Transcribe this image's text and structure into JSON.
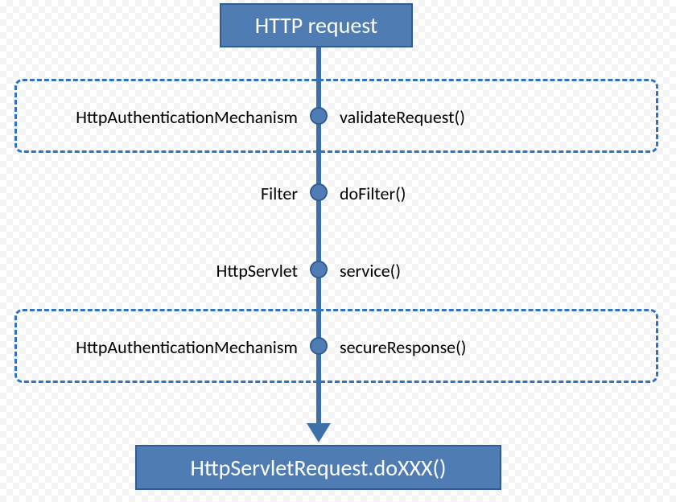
{
  "top_box": {
    "label": "HTTP request"
  },
  "bottom_box": {
    "label": "HttpServletRequest.doXXX()"
  },
  "steps": [
    {
      "component": "HttpAuthenticationMechanism",
      "method": "validateRequest()"
    },
    {
      "component": "Filter",
      "method": "doFilter()"
    },
    {
      "component": "HttpServlet",
      "method": "service()"
    },
    {
      "component": "HttpAuthenticationMechanism",
      "method": "secureResponse()"
    }
  ],
  "colors": {
    "fill": "#4f7db3",
    "stroke": "#2f5d93",
    "dashed": "#2f74bf"
  }
}
